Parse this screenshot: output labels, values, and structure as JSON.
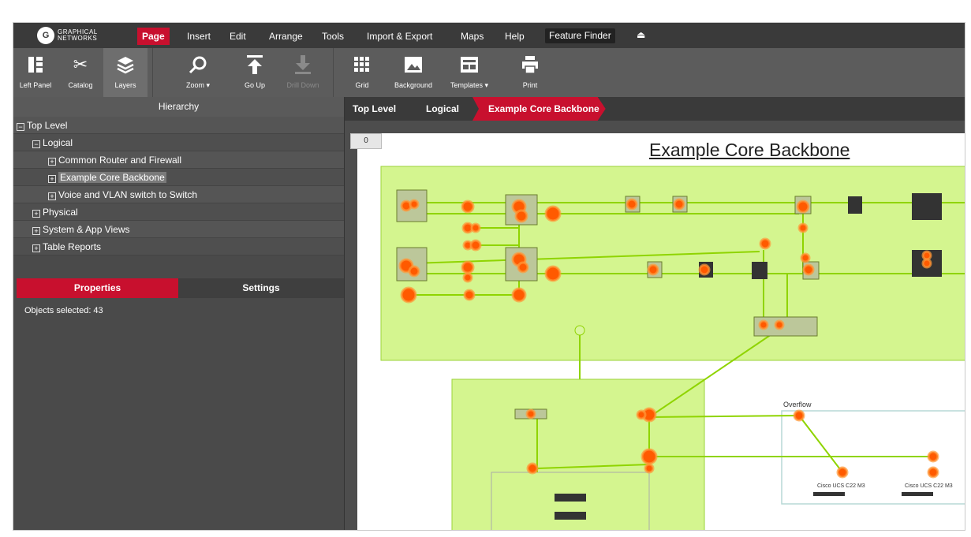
{
  "logo": {
    "mark": "G",
    "line1": "GRAPHICAL",
    "line2": "NETWORKS"
  },
  "menu": [
    "Page",
    "Insert",
    "Edit",
    "Arrange",
    "Tools",
    "Import & Export",
    "Maps",
    "Help"
  ],
  "feature_finder": "Feature Finder",
  "toolbar": {
    "left_panel": "Left Panel",
    "catalog": "Catalog",
    "layers": "Layers",
    "zoom": "Zoom ▾",
    "go_up": "Go Up",
    "drill_down": "Drill Down",
    "grid": "Grid",
    "background": "Background",
    "templates": "Templates ▾",
    "print": "Print"
  },
  "hierarchy": {
    "title": "Hierarchy",
    "items": [
      {
        "label": "Top Level",
        "toggle": "−"
      },
      {
        "label": "Logical",
        "toggle": "−"
      },
      {
        "label": "Common Router and Firewall",
        "toggle": "+"
      },
      {
        "label": "Example Core Backbone",
        "toggle": "+"
      },
      {
        "label": "Voice and VLAN switch to Switch",
        "toggle": "+"
      },
      {
        "label": "Physical",
        "toggle": "+"
      },
      {
        "label": "System & App Views",
        "toggle": "+"
      },
      {
        "label": "Table Reports",
        "toggle": "+"
      }
    ]
  },
  "tabs": {
    "properties": "Properties",
    "settings": "Settings"
  },
  "properties": {
    "selected_text": "Objects selected: 43"
  },
  "breadcrumbs": [
    "Top Level",
    "Logical",
    "Example Core Backbone"
  ],
  "canvas": {
    "zoom_badge": "0",
    "title": "Example Core Backbone",
    "overflow_label": "Overflow",
    "devices": [
      "Cisco UCS C22 M3",
      "Cisco UCS C22 M3"
    ]
  },
  "colors": {
    "accent": "#c8102e",
    "highlight_green": "#c6f26a",
    "node_orange": "#ff5a00"
  }
}
